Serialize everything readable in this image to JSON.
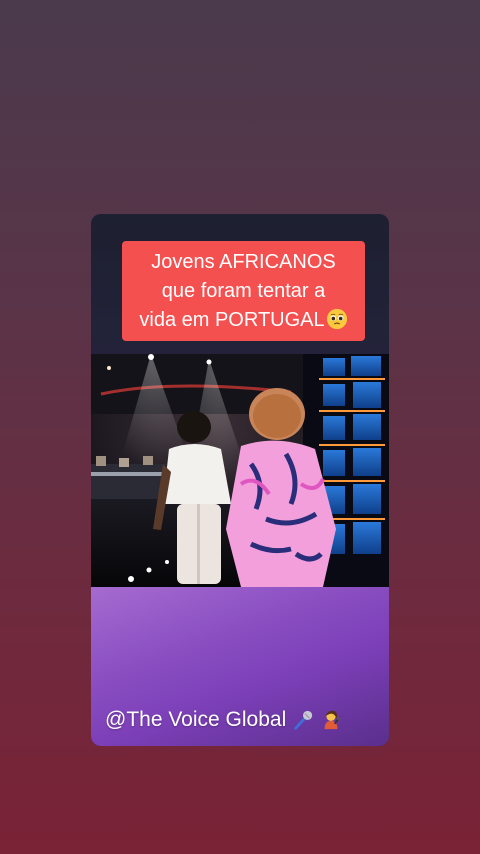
{
  "post": {
    "caption": "Jovens AFRICANOS\nque foram tentar a\nvida em PORTUGAL",
    "caption_emoji": "pleading-face-icon",
    "handle": "@The Voice Global",
    "handle_icons": [
      "microphone-icon",
      "singer-icon"
    ]
  },
  "colors": {
    "caption_bg": "#f4504f",
    "bottom_panel": "#8b4fc2",
    "page_bg_top": "#4a3a4c",
    "page_bg_bottom": "#7a2236"
  }
}
